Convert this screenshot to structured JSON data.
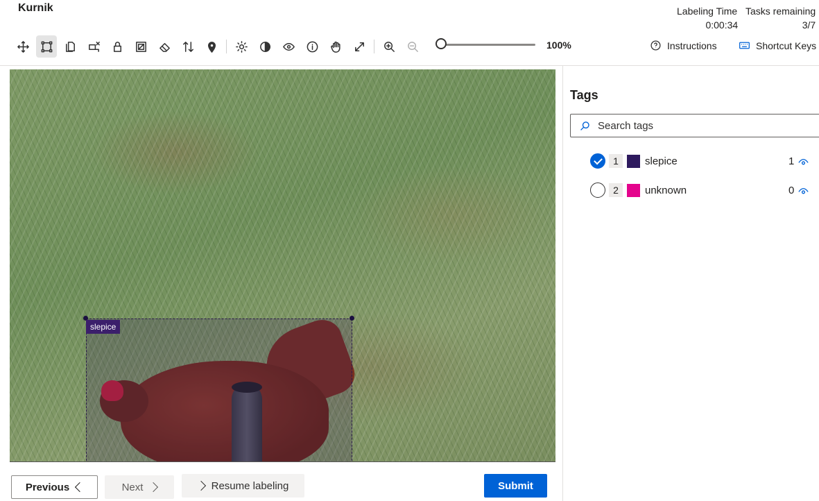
{
  "app": {
    "title": "Kurnik",
    "labeling_time_label": "Labeling Time",
    "labeling_time_value": "0:00:34",
    "tasks_remaining_label": "Tasks remaining",
    "tasks_remaining_value": "3/7"
  },
  "toolbar": {
    "tools": [
      {
        "name": "move-icon",
        "active": false
      },
      {
        "name": "rectangle-icon",
        "active": true
      },
      {
        "name": "copy-icon",
        "active": false
      },
      {
        "name": "remove-region-icon",
        "active": false
      },
      {
        "name": "lock-icon",
        "active": false
      },
      {
        "name": "select-all-icon",
        "active": false
      },
      {
        "name": "eraser-icon",
        "active": false
      },
      {
        "name": "sort-icon",
        "active": false
      },
      {
        "name": "pin-icon",
        "active": false
      },
      {
        "name": "brightness-icon",
        "active": false
      },
      {
        "name": "contrast-icon",
        "active": false
      },
      {
        "name": "eye-icon",
        "active": false
      },
      {
        "name": "info-icon",
        "active": false
      },
      {
        "name": "hand-icon",
        "active": false
      },
      {
        "name": "expand-icon",
        "active": false
      },
      {
        "name": "zoom-in-icon",
        "active": false
      },
      {
        "name": "zoom-out-icon",
        "active": false
      }
    ],
    "zoom_value": "100%",
    "instructions_label": "Instructions",
    "shortcut_keys_label": "Shortcut Keys"
  },
  "canvas": {
    "region_label": "slepice"
  },
  "footer": {
    "previous_label": "Previous",
    "next_label": "Next",
    "resume_label": "Resume labeling",
    "submit_label": "Submit"
  },
  "tags_panel": {
    "title": "Tags",
    "search_placeholder": "Search tags",
    "items": [
      {
        "index": "1",
        "name": "slepice",
        "color": "#2e1a5e",
        "count": "1",
        "checked": true
      },
      {
        "index": "2",
        "name": "unknown",
        "color": "#e4048c",
        "count": "0",
        "checked": false
      }
    ]
  },
  "colors": {
    "accent": "#0062d6",
    "region_label_bg": "#3b1f6b"
  }
}
